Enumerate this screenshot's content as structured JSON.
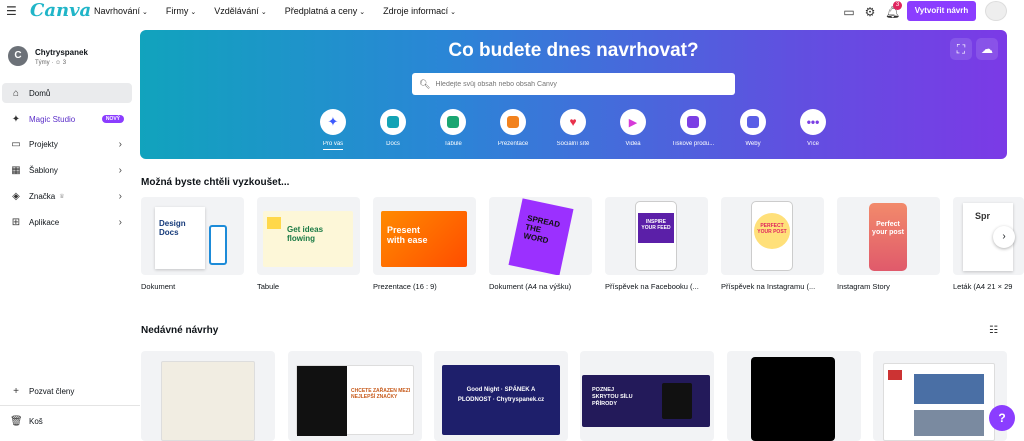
{
  "topbar": {
    "logo": "Canva",
    "nav": [
      "Navrhování",
      "Firmy",
      "Vzdělávání",
      "Předplatná a ceny",
      "Zdroje informací"
    ],
    "notification_count": "3",
    "create_label": "Vytvořit návrh"
  },
  "account": {
    "initial": "C",
    "name": "Chytryspanek",
    "sub": "Týmy · ☺ 3"
  },
  "sidebar": {
    "items": [
      {
        "label": "Domů"
      },
      {
        "label": "Magic Studio",
        "badge": "NOVÝ"
      },
      {
        "label": "Projekty"
      },
      {
        "label": "Šablony"
      },
      {
        "label": "Značka"
      },
      {
        "label": "Aplikace"
      }
    ],
    "invite": "Pozvat členy",
    "trash": "Koš"
  },
  "hero": {
    "title": "Co budete dnes navrhovat?",
    "search_placeholder": "Hledejte svůj obsah nebo obsah Canvy",
    "categories": [
      {
        "label": "Pro vás",
        "icon": "sparkle-icon",
        "color": "#3d5afe"
      },
      {
        "label": "Docs",
        "icon": "docs-icon",
        "color": "#13a3b5"
      },
      {
        "label": "Tabule",
        "icon": "whiteboard-icon",
        "color": "#1ba672"
      },
      {
        "label": "Prezentace",
        "icon": "presentation-icon",
        "color": "#f2821e"
      },
      {
        "label": "Sociální sítě",
        "icon": "heart-icon",
        "color": "#e8314b"
      },
      {
        "label": "Videa",
        "icon": "video-icon",
        "color": "#d63ad8"
      },
      {
        "label": "Tiskové produ...",
        "icon": "print-icon",
        "color": "#7b3fe4"
      },
      {
        "label": "Weby",
        "icon": "web-icon",
        "color": "#5a5ee6"
      },
      {
        "label": "Více",
        "icon": "more-icon",
        "color": "#7b3fe4"
      }
    ]
  },
  "suggest": {
    "title": "Možná byste chtěli vyzkoušet...",
    "items": [
      {
        "label": "Dokument",
        "thumb_text": "Design Docs"
      },
      {
        "label": "Tabule",
        "thumb_text": "Get ideas flowing"
      },
      {
        "label": "Prezentace (16 : 9)",
        "thumb_text": "Present with ease"
      },
      {
        "label": "Dokument (A4 na výšku)",
        "thumb_text": "SPREAD THE WORD"
      },
      {
        "label": "Příspěvek na Facebooku (...",
        "thumb_text": "INSPIRE YOUR FEED"
      },
      {
        "label": "Příspěvek na Instagramu (...",
        "thumb_text": "PERFECT YOUR POST"
      },
      {
        "label": "Instagram Story",
        "thumb_text": "Perfect your post"
      },
      {
        "label": "Leták (A4 21 × 29",
        "thumb_text": "Spr"
      }
    ]
  },
  "recent": {
    "title": "Nedávné návrhy",
    "items": [
      {
        "text": ""
      },
      {
        "text": "CHCETE ZAŘAZEN MEZI NEJLEPŠÍ ZNAČKY"
      },
      {
        "text": "Good Night · SPÁNEK A PLODNOST · Chytryspanek.cz"
      },
      {
        "text": "POZNEJ SKRYTOU SÍLU PŘÍRODY"
      },
      {
        "text": ""
      },
      {
        "text": ""
      }
    ]
  },
  "colors": {
    "brand": "#8b3dff",
    "logo": "#20b5c8"
  }
}
